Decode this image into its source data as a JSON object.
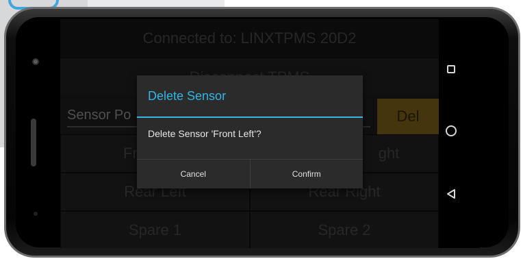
{
  "app": {
    "connected_label": "Connected to: LINXTPMS 20D2",
    "disconnect_label": "Disconnect TPMS",
    "sensor_label": "Sensor Po",
    "delete_label": "Del",
    "grid": [
      {
        "left": "Front Left",
        "right": "Front Right"
      },
      {
        "left": "Rear Left",
        "right": "Rear Right"
      },
      {
        "left": "Spare 1",
        "right": "Spare 2"
      }
    ],
    "grid_visible": [
      {
        "left": "Fro",
        "right": "ght"
      },
      {
        "left": "Rear Left",
        "right": "Rear Right"
      },
      {
        "left": "Spare 1",
        "right": "Spare 2"
      }
    ]
  },
  "dialog": {
    "title": "Delete Sensor",
    "message": "Delete Sensor 'Front Left'?",
    "cancel_label": "Cancel",
    "confirm_label": "Confirm"
  },
  "nav": {
    "recents_icon": "square-icon",
    "home_icon": "circle-icon",
    "back_icon": "triangle-back-icon"
  },
  "colors": {
    "accent": "#33b5e5",
    "delete_button": "#6b5215",
    "dialog_bg": "#2b2b2b",
    "screen_bg": "#1a1a1a"
  }
}
